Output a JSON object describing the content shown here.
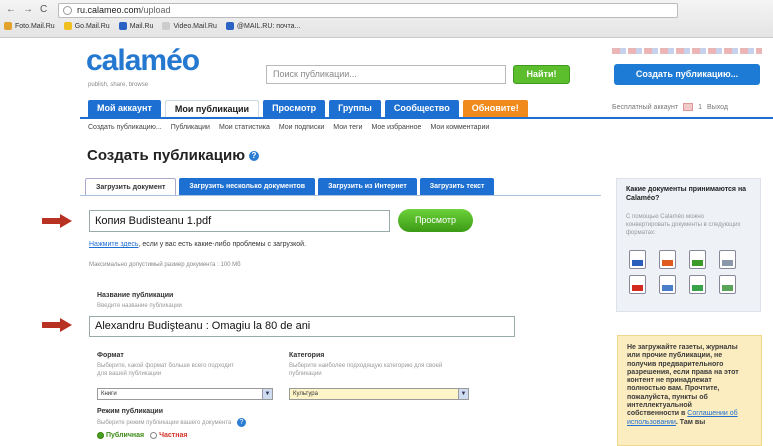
{
  "browser": {
    "back": "←",
    "forward": "→",
    "reload": "C",
    "url_domain": "ru.calameo.com",
    "url_path": "/upload",
    "bookmarks": [
      {
        "label": "Foto.Mail.Ru",
        "color": "#e3a12e"
      },
      {
        "label": "Go.Mail.Ru",
        "color": "#f0c020"
      },
      {
        "label": "Mail.Ru",
        "color": "#2a63c4"
      },
      {
        "label": "Video.Mail.Ru",
        "color": "#cccccc"
      },
      {
        "label": "@MAIL.RU: почта...",
        "color": "#2a63c4"
      }
    ]
  },
  "header": {
    "logo": "calaméo",
    "tagline": "publish, share, browse",
    "search_placeholder": "Поиск публикации...",
    "find_button": "Найти!",
    "create_button": "Создать публикацию..."
  },
  "main_tabs": [
    {
      "label": "Мой аккаунт",
      "state": "normal"
    },
    {
      "label": "Мои публикации",
      "state": "active"
    },
    {
      "label": "Просмотр",
      "state": "normal"
    },
    {
      "label": "Группы",
      "state": "normal"
    },
    {
      "label": "Сообщество",
      "state": "normal"
    },
    {
      "label": "Обновите!",
      "state": "update"
    }
  ],
  "account": {
    "type": "Бесплатный аккаунт",
    "count": "1",
    "logout": "Выход"
  },
  "sub_nav": [
    "Создать публикацию...",
    "Публикации",
    "Мои статистика",
    "Мои подписки",
    "Мои теги",
    "Мое избранное",
    "Мои комментарии"
  ],
  "page": {
    "title": "Создать публикацию",
    "help_glyph": "?"
  },
  "upload_tabs": [
    {
      "label": "Загрузить документ",
      "active": true
    },
    {
      "label": "Загрузить несколько документов",
      "active": false
    },
    {
      "label": "Загрузить из Интернет",
      "active": false
    },
    {
      "label": "Загрузить текст",
      "active": false
    }
  ],
  "form": {
    "file_value": "Копия Budisteanu 1.pdf",
    "browse_button": "Просмотр",
    "help_link": "Нажмите здесь",
    "help_text": ", если у вас есть какие-либо проблемы с загрузкой.",
    "max_size": "Максимально допустимый размер документа : 100 Мб",
    "pub_title_label": "Название публикации",
    "pub_title_hint": "Введите название публикации",
    "pub_title_value": "Alexandru Budişteanu : Omagiu la 80 de ani",
    "format_label": "Формат",
    "format_hint": "Выберите, какой формат больше всего подходит для вашей публикации",
    "format_value": "Книги",
    "category_label": "Категория",
    "category_hint": "Выберите наиболее подходящую категорию для своей публикации",
    "category_value": "Культура",
    "mode_label": "Режим публикации",
    "mode_hint": "Выберите режим публикации вашего документа",
    "mode_public": "Публичная",
    "mode_private": "Частная"
  },
  "sidebar": {
    "box1_title": "Какие документы принимаются на Calaméo?",
    "box1_text": "С помощью Calaméo можно конвертировать документы в следующих форматах:",
    "icons": [
      "word-doc-icon",
      "ppt-doc-icon",
      "xls-doc-icon",
      "txt-doc-icon",
      "pdf-doc-icon",
      "odt-doc-icon",
      "ods-doc-icon",
      "rtf-doc-icon"
    ],
    "box2_text": "Не загружайте газеты, журналы или прочие публикации, не получив предварительного разрешения, если права на этот контент не принадлежат полностью вам. Прочтите, пожалуйста, пункты об интеллектуальной собственности в ",
    "box2_link": "Соглашении об использовании",
    "box2_tail": ". Там вы"
  }
}
